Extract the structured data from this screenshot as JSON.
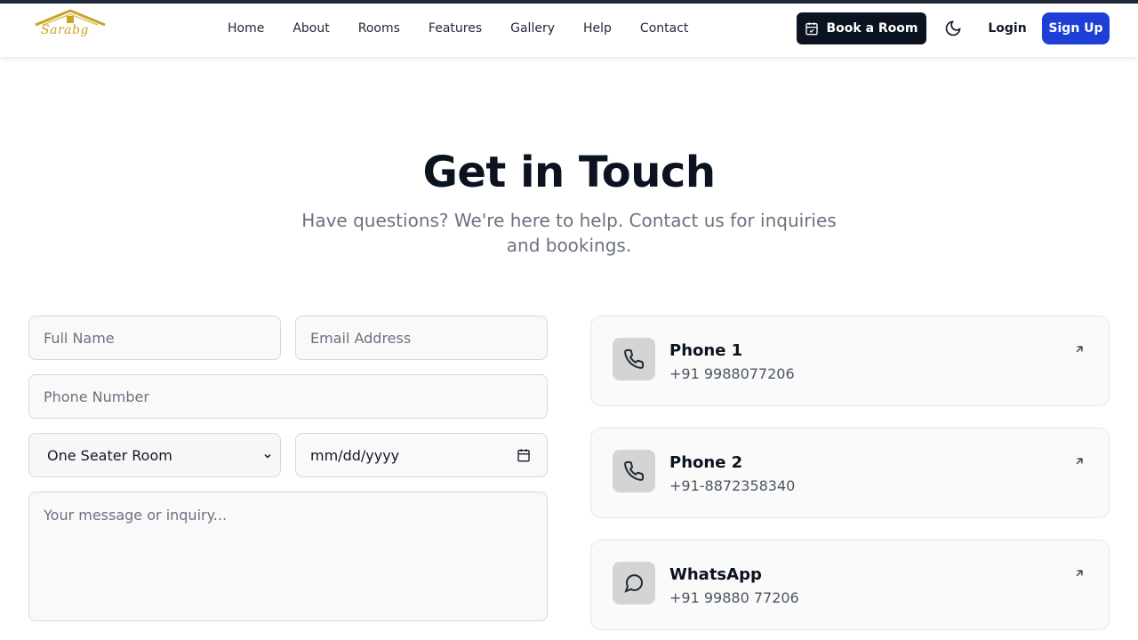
{
  "nav": {
    "logo_text": "Sarabg",
    "links": [
      "Home",
      "About",
      "Rooms",
      "Features",
      "Gallery",
      "Help",
      "Contact"
    ],
    "book_label": "Book a Room",
    "login_label": "Login",
    "signup_label": "Sign Up"
  },
  "hero": {
    "title": "Get in Touch",
    "subtitle": "Have questions? We're here to help. Contact us for inquiries and bookings."
  },
  "form": {
    "name_placeholder": "Full Name",
    "email_placeholder": "Email Address",
    "phone_placeholder": "Phone Number",
    "room_selected": "One Seater Room",
    "date_placeholder": "mm/dd/yyyy",
    "message_placeholder": "Your message or inquiry..."
  },
  "contacts": [
    {
      "title": "Phone 1",
      "value": "+91 9988077206",
      "icon": "phone-icon"
    },
    {
      "title": "Phone 2",
      "value": "+91-8872358340",
      "icon": "phone-icon"
    },
    {
      "title": "WhatsApp",
      "value": "+91 99880 77206",
      "icon": "message-circle-icon"
    }
  ],
  "colors": {
    "primary_dark": "#0b1220",
    "accent_blue": "#1d3fd8",
    "logo_gold": "#c9a227"
  }
}
